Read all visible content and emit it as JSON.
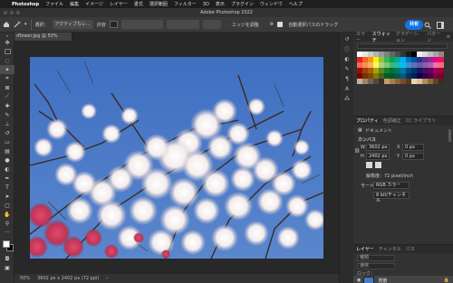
{
  "menubar": {
    "app": "Photoshop",
    "items": [
      "ファイル",
      "編集",
      "イメージ",
      "レイヤー",
      "書式",
      "選択範囲",
      "フィルター",
      "3D",
      "表示",
      "プラグイン",
      "ウィンドウ",
      "ヘルプ"
    ]
  },
  "window": {
    "title": "Adobe Photoshop 2022"
  },
  "options": {
    "sample_label": "選択：",
    "sample_value": "アクティブなレ...",
    "tolerance_label": "許容",
    "edge_label": "エッジを調整",
    "drag_label": "自動選択パスのドラッグ",
    "share_label": "共有"
  },
  "document": {
    "tab": "flower.jpg @ 50% (RGB/8)",
    "zoom": "50%",
    "size": "3602 px x 2402 px (72 ppi)"
  },
  "swatches_panel": {
    "tabs": [
      "カラー",
      "スウォッチ",
      "グラデーション",
      "パターン"
    ],
    "active_tab": "スウォッチ",
    "colors": [
      "#ffffff",
      "#e6e6e6",
      "#cccccc",
      "#b3b3b3",
      "#999999",
      "#808080",
      "#666666",
      "#4d4d4d",
      "#333333",
      "#1a1a1a",
      "#000000",
      "#f0f0f0",
      "#d9d9d9",
      "#bfbfbf",
      "#a6a6a6",
      "#8c8c8c",
      "#ed1c24",
      "#f26522",
      "#f7941d",
      "#fff200",
      "#8dc63f",
      "#39b54a",
      "#00a651",
      "#00a99d",
      "#00aeef",
      "#0072bc",
      "#0054a6",
      "#2e3192",
      "#662d91",
      "#92278f",
      "#ec008c",
      "#ed145b",
      "#f26c4f",
      "#f68e55",
      "#fbaf5c",
      "#fff467",
      "#acd372",
      "#7cc576",
      "#3bb878",
      "#1abbb4",
      "#00bff3",
      "#438ccb",
      "#5574b9",
      "#605ca8",
      "#855fa8",
      "#a763a8",
      "#f06eaa",
      "#f26d7d",
      "#9e0b0f",
      "#a0410d",
      "#a36209",
      "#aba000",
      "#598527",
      "#1a7b30",
      "#007236",
      "#00746b",
      "#0076a3",
      "#004b80",
      "#003471",
      "#1b1464",
      "#440e62",
      "#630460",
      "#9e005d",
      "#9e0039",
      "#790000",
      "#7b2e00",
      "#7d4900",
      "#827b00",
      "#406618",
      "#005e20",
      "#005826",
      "#005952",
      "#005b7f",
      "#003663",
      "#002157",
      "#0d004c",
      "#32004b",
      "#4b0049",
      "#7b0046",
      "#7a0026",
      "#c7b299",
      "#998675",
      "#736357",
      "#534741",
      "#37302d",
      "#c69c6d",
      "#a67c52",
      "#8c6239",
      "#754c24",
      "#603813",
      "#e8d5b7",
      "#d9c09c",
      "#b08d57",
      "#8a6a3a",
      "#5c4424",
      "#3d2c17"
    ]
  },
  "properties_panel": {
    "tabs": [
      "プロパティ",
      "色調補正",
      "CC ライブラリ"
    ],
    "active_tab": "プロパティ",
    "doc_label": "ドキュメント",
    "canvas_label": "カンバス",
    "w_label": "W",
    "w_value": "3602 px",
    "h_label": "H",
    "h_value": "2402 px",
    "x_label": "X",
    "x_value": "0 px",
    "y_label": "Y",
    "y_value": "0 px",
    "resolution": "解像度：72 pixel/inch",
    "mode_label": "モード",
    "mode_value": "RGB カラー",
    "bits_value": "8 bit/チャンネル"
  },
  "layers_panel": {
    "tabs": [
      "レイヤー",
      "チャンネル",
      "パス"
    ],
    "active_tab": "レイヤー",
    "kind_label": "種類",
    "blend_label": "通常",
    "lock_label": "ロック：",
    "layer_name": "背景"
  },
  "colors": {
    "accent": "#1473e6",
    "sky": "#4a78c4"
  }
}
